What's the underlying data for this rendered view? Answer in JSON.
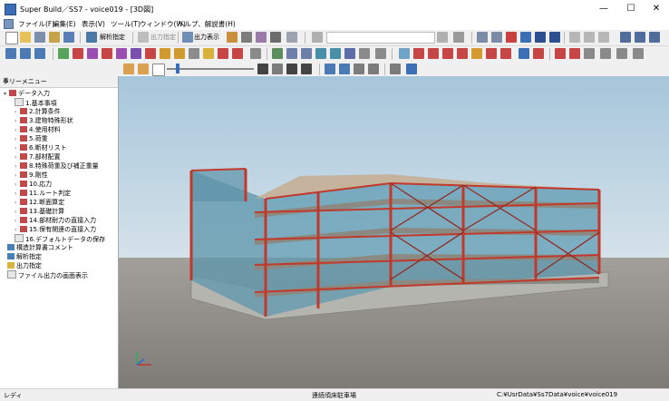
{
  "window": {
    "title": "Super Build／SS7 - voice019 - [3D図]",
    "minimize": "—",
    "maximize": "☐",
    "close": "✕"
  },
  "menu": [
    "ファイル(F)",
    "編集(E)",
    "表示(V)",
    "ツール(T)",
    "ウィンドウ(W)",
    "ヘルプ、解説書(H)"
  ],
  "toolbar": {
    "analysis_button": "解析指定",
    "output_button": "出力指定",
    "output_display_button": "出力表示"
  },
  "tree": {
    "header": "ツリーメニュー",
    "root": "データ入力",
    "children": [
      "1.基本事項",
      "2.計算条件",
      "3.建物特殊形状",
      "4.使用材料",
      "5.荷重",
      "6.断材リスト",
      "7.部材配置",
      "8.特殊荷重及び補正重量",
      "9.剛性",
      "10.応力",
      "11.ルート判定",
      "12.断面算定",
      "13.基礎計算",
      "14.部材耐力の直接入力",
      "15.保有関連の直接入力",
      "16.デフォルトデータの保存"
    ],
    "others": [
      "構造計算書コメント",
      "解析指定",
      "出力指定",
      "ファイル出力の画面表示"
    ]
  },
  "status": {
    "left": "レディ",
    "middle": "連続頃床駐車場",
    "right": "C:¥UsrData¥Ss7Data¥voice¥voice019"
  },
  "colors": {
    "steel": "#c0392b",
    "glass": "#5c98b0",
    "floor": "#8a8a82",
    "sky_top": "#9fc1d8",
    "ground": "#8c8783"
  }
}
